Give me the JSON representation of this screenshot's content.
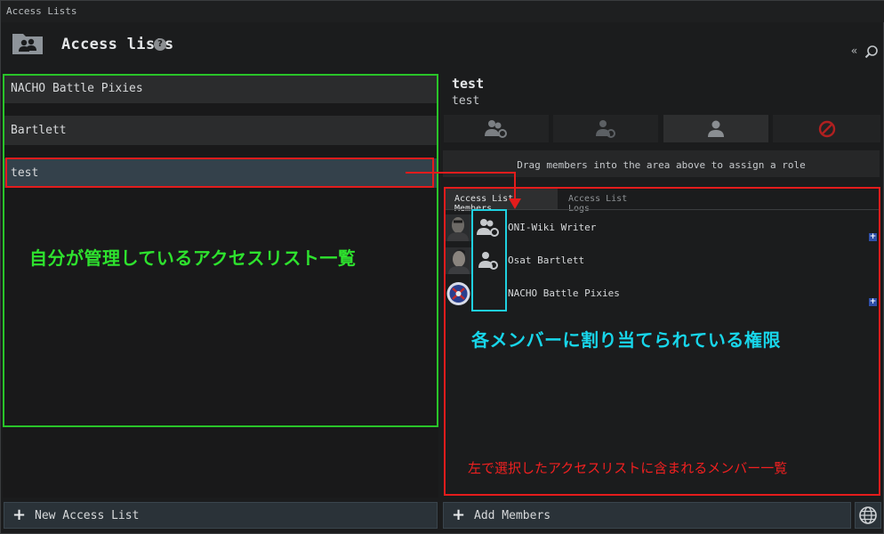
{
  "window": {
    "title": "Access Lists"
  },
  "header": {
    "title": "Access lists",
    "help": "?",
    "collapse": "«"
  },
  "access_lists": [
    {
      "label": "NACHO Battle Pixies",
      "selected": false
    },
    {
      "label": "Bartlett",
      "selected": false
    },
    {
      "label": "test",
      "selected": true
    }
  ],
  "detail": {
    "name": "test",
    "description": "test",
    "drag_hint": "Drag members into the area above to assign a role"
  },
  "roles": [
    "manager-icon",
    "admin-icon",
    "member-icon",
    "blocked-icon"
  ],
  "tabs": [
    {
      "label": "Access List Members",
      "active": true
    },
    {
      "label": "Access List Logs",
      "active": false
    }
  ],
  "members": [
    {
      "name": "ONI-Wiki Writer",
      "role": "manager-icon"
    },
    {
      "name": "Osat Bartlett",
      "role": "admin-icon"
    },
    {
      "name": "NACHO Battle Pixies",
      "role": ""
    }
  ],
  "buttons": {
    "new_list": "New Access List",
    "add_members": "Add Members",
    "plus": "+"
  },
  "annotations": {
    "green": "自分が管理しているアクセスリスト一覧",
    "cyan": "各メンバーに割り当てられている権限",
    "red": "左で選択したアクセスリストに含まれるメンバー一覧"
  },
  "colors": {
    "green": "#29c429",
    "cyan": "#1fd0e0",
    "red": "#e41c1c",
    "selected_row": "#34414b"
  }
}
